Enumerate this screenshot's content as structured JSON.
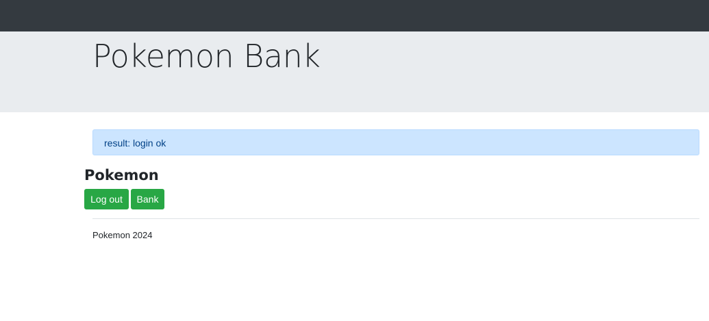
{
  "header": {
    "title": "Pokemon Bank"
  },
  "alert": {
    "message": "result: login ok"
  },
  "main": {
    "heading": "Pokemon",
    "buttons": {
      "logout_label": "Log out",
      "bank_label": "Bank"
    }
  },
  "footer": {
    "text": "Pokemon 2024"
  },
  "colors": {
    "navbar": "#343a40",
    "jumbotron": "#e9ecef",
    "alert_bg": "#cce5ff",
    "alert_text": "#004085",
    "button": "#28a745"
  }
}
